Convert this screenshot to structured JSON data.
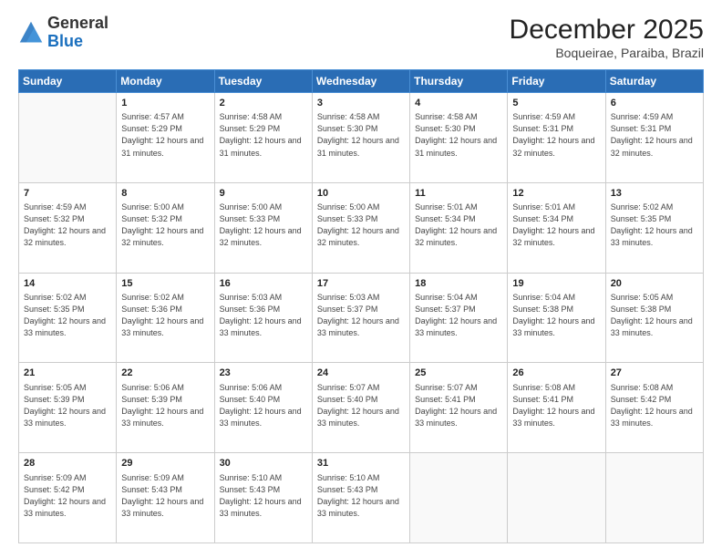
{
  "logo": {
    "general": "General",
    "blue": "Blue"
  },
  "header": {
    "month": "December 2025",
    "location": "Boqueirae, Paraiba, Brazil"
  },
  "weekdays": [
    "Sunday",
    "Monday",
    "Tuesday",
    "Wednesday",
    "Thursday",
    "Friday",
    "Saturday"
  ],
  "weeks": [
    [
      {
        "day": "",
        "info": ""
      },
      {
        "day": "1",
        "info": "Sunrise: 4:57 AM\nSunset: 5:29 PM\nDaylight: 12 hours and 31 minutes."
      },
      {
        "day": "2",
        "info": "Sunrise: 4:58 AM\nSunset: 5:29 PM\nDaylight: 12 hours and 31 minutes."
      },
      {
        "day": "3",
        "info": "Sunrise: 4:58 AM\nSunset: 5:30 PM\nDaylight: 12 hours and 31 minutes."
      },
      {
        "day": "4",
        "info": "Sunrise: 4:58 AM\nSunset: 5:30 PM\nDaylight: 12 hours and 31 minutes."
      },
      {
        "day": "5",
        "info": "Sunrise: 4:59 AM\nSunset: 5:31 PM\nDaylight: 12 hours and 32 minutes."
      },
      {
        "day": "6",
        "info": "Sunrise: 4:59 AM\nSunset: 5:31 PM\nDaylight: 12 hours and 32 minutes."
      }
    ],
    [
      {
        "day": "7",
        "info": "Sunrise: 4:59 AM\nSunset: 5:32 PM\nDaylight: 12 hours and 32 minutes."
      },
      {
        "day": "8",
        "info": "Sunrise: 5:00 AM\nSunset: 5:32 PM\nDaylight: 12 hours and 32 minutes."
      },
      {
        "day": "9",
        "info": "Sunrise: 5:00 AM\nSunset: 5:33 PM\nDaylight: 12 hours and 32 minutes."
      },
      {
        "day": "10",
        "info": "Sunrise: 5:00 AM\nSunset: 5:33 PM\nDaylight: 12 hours and 32 minutes."
      },
      {
        "day": "11",
        "info": "Sunrise: 5:01 AM\nSunset: 5:34 PM\nDaylight: 12 hours and 32 minutes."
      },
      {
        "day": "12",
        "info": "Sunrise: 5:01 AM\nSunset: 5:34 PM\nDaylight: 12 hours and 32 minutes."
      },
      {
        "day": "13",
        "info": "Sunrise: 5:02 AM\nSunset: 5:35 PM\nDaylight: 12 hours and 33 minutes."
      }
    ],
    [
      {
        "day": "14",
        "info": "Sunrise: 5:02 AM\nSunset: 5:35 PM\nDaylight: 12 hours and 33 minutes."
      },
      {
        "day": "15",
        "info": "Sunrise: 5:02 AM\nSunset: 5:36 PM\nDaylight: 12 hours and 33 minutes."
      },
      {
        "day": "16",
        "info": "Sunrise: 5:03 AM\nSunset: 5:36 PM\nDaylight: 12 hours and 33 minutes."
      },
      {
        "day": "17",
        "info": "Sunrise: 5:03 AM\nSunset: 5:37 PM\nDaylight: 12 hours and 33 minutes."
      },
      {
        "day": "18",
        "info": "Sunrise: 5:04 AM\nSunset: 5:37 PM\nDaylight: 12 hours and 33 minutes."
      },
      {
        "day": "19",
        "info": "Sunrise: 5:04 AM\nSunset: 5:38 PM\nDaylight: 12 hours and 33 minutes."
      },
      {
        "day": "20",
        "info": "Sunrise: 5:05 AM\nSunset: 5:38 PM\nDaylight: 12 hours and 33 minutes."
      }
    ],
    [
      {
        "day": "21",
        "info": "Sunrise: 5:05 AM\nSunset: 5:39 PM\nDaylight: 12 hours and 33 minutes."
      },
      {
        "day": "22",
        "info": "Sunrise: 5:06 AM\nSunset: 5:39 PM\nDaylight: 12 hours and 33 minutes."
      },
      {
        "day": "23",
        "info": "Sunrise: 5:06 AM\nSunset: 5:40 PM\nDaylight: 12 hours and 33 minutes."
      },
      {
        "day": "24",
        "info": "Sunrise: 5:07 AM\nSunset: 5:40 PM\nDaylight: 12 hours and 33 minutes."
      },
      {
        "day": "25",
        "info": "Sunrise: 5:07 AM\nSunset: 5:41 PM\nDaylight: 12 hours and 33 minutes."
      },
      {
        "day": "26",
        "info": "Sunrise: 5:08 AM\nSunset: 5:41 PM\nDaylight: 12 hours and 33 minutes."
      },
      {
        "day": "27",
        "info": "Sunrise: 5:08 AM\nSunset: 5:42 PM\nDaylight: 12 hours and 33 minutes."
      }
    ],
    [
      {
        "day": "28",
        "info": "Sunrise: 5:09 AM\nSunset: 5:42 PM\nDaylight: 12 hours and 33 minutes."
      },
      {
        "day": "29",
        "info": "Sunrise: 5:09 AM\nSunset: 5:43 PM\nDaylight: 12 hours and 33 minutes."
      },
      {
        "day": "30",
        "info": "Sunrise: 5:10 AM\nSunset: 5:43 PM\nDaylight: 12 hours and 33 minutes."
      },
      {
        "day": "31",
        "info": "Sunrise: 5:10 AM\nSunset: 5:43 PM\nDaylight: 12 hours and 33 minutes."
      },
      {
        "day": "",
        "info": ""
      },
      {
        "day": "",
        "info": ""
      },
      {
        "day": "",
        "info": ""
      }
    ]
  ]
}
